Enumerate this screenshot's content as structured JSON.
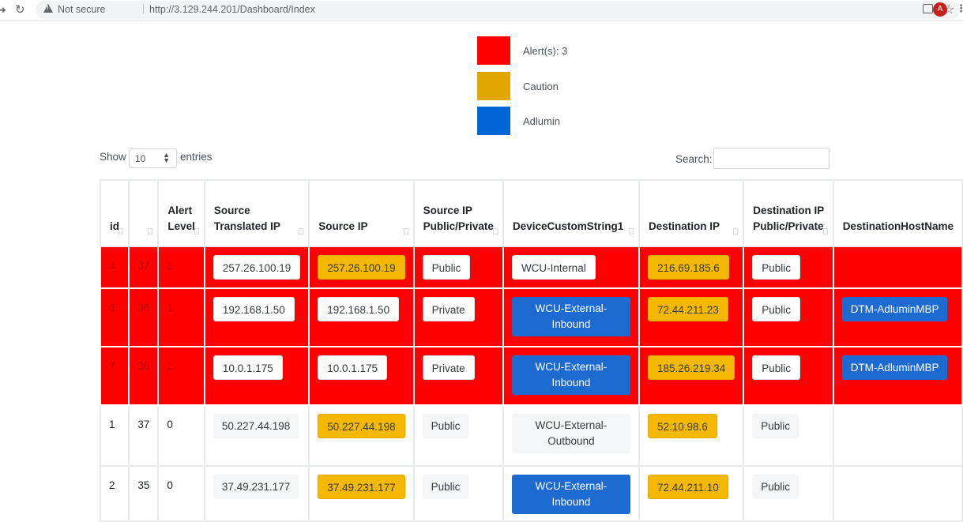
{
  "browser": {
    "security_label": "Not secure",
    "separator": "|",
    "url": "http://3.129.244.201/Dashboard/Index",
    "avatar_letter": "A"
  },
  "legend": [
    {
      "label": "Alert(s): 3",
      "color": "#ff0000"
    },
    {
      "label": "Caution",
      "color": "#e0a800"
    },
    {
      "label": "Adlumin",
      "color": "#0066d6"
    }
  ],
  "table_controls": {
    "show_label": "Show",
    "entries_label": "entries",
    "page_length": "10",
    "search_label": "Search:",
    "search_value": ""
  },
  "table": {
    "columns": [
      "id",
      "",
      "Alert Level",
      "Source Translated IP",
      "Source IP",
      "Source IP Public/Private",
      "DeviceCustomString1",
      "Destination IP",
      "Destination IP Public/Private",
      "DestinationHostName"
    ],
    "rows": [
      {
        "state": "alert",
        "id": "4",
        "n": "37",
        "level": "1",
        "src_translated": "257.26.100.19",
        "src_ip": "257.26.100.19",
        "src_pp": "Public",
        "dcs1": "WCU-Internal",
        "dcs1_style": "white",
        "dst_ip": "216.69.185.6",
        "dst_pp": "Public",
        "dst_host": ""
      },
      {
        "state": "alert",
        "id": "6",
        "n": "36",
        "level": "1",
        "src_translated": "192.168.1.50",
        "src_ip": "192.168.1.50",
        "src_pp": "Private",
        "dcs1": "WCU-External-Inbound",
        "dcs1_style": "blue",
        "dst_ip": "72.44.211.23",
        "dst_pp": "Public",
        "dst_host": "DTM-AdluminMBP"
      },
      {
        "state": "alert",
        "id": "7",
        "n": "36",
        "level": "1",
        "src_translated": "10.0.1.175",
        "src_ip": "10.0.1.175",
        "src_pp": "Private",
        "dcs1": "WCU-External-Inbound",
        "dcs1_style": "blue",
        "dst_ip": "185.26.219.34",
        "dst_pp": "Public",
        "dst_host": "DTM-AdluminMBP"
      },
      {
        "state": "plain",
        "id": "1",
        "n": "37",
        "level": "0",
        "src_translated": "50.227.44.198",
        "src_ip": "50.227.44.198",
        "src_pp": "Public",
        "dcs1": "WCU-External-Outbound",
        "dcs1_style": "light",
        "dst_ip": "52.10.98.6",
        "dst_pp": "Public",
        "dst_host": ""
      },
      {
        "state": "plain",
        "id": "2",
        "n": "35",
        "level": "0",
        "src_translated": "37.49.231.177",
        "src_ip": "37.49.231.177",
        "src_pp": "Public",
        "dcs1": "WCU-External-Inbound",
        "dcs1_style": "blue",
        "dst_ip": "72.44.211.10",
        "dst_pp": "Public",
        "dst_host": ""
      }
    ]
  }
}
